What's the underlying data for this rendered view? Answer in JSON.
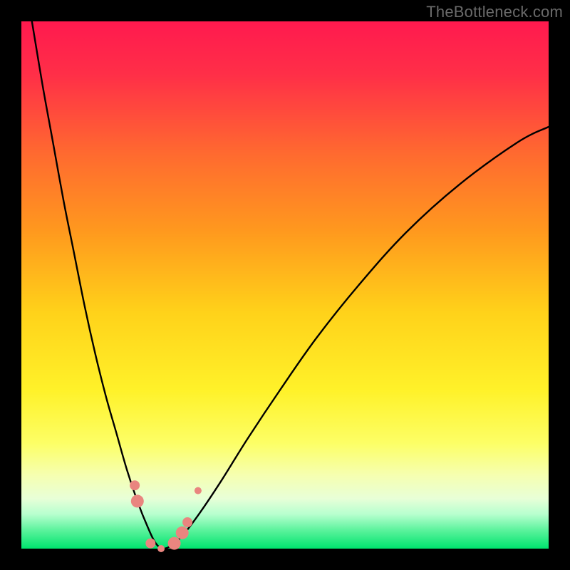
{
  "watermark": "TheBottleneck.com",
  "frame": {
    "outer_w": 800,
    "outer_h": 800,
    "inner_x": 30,
    "inner_y": 30,
    "inner_w": 740,
    "inner_h": 740
  },
  "gradient": {
    "stops": [
      {
        "offset": 0.0,
        "color": "#ff1a4f"
      },
      {
        "offset": 0.1,
        "color": "#ff2f48"
      },
      {
        "offset": 0.25,
        "color": "#ff6a30"
      },
      {
        "offset": 0.4,
        "color": "#ff9a1e"
      },
      {
        "offset": 0.55,
        "color": "#ffd21a"
      },
      {
        "offset": 0.7,
        "color": "#fff22a"
      },
      {
        "offset": 0.8,
        "color": "#fdff66"
      },
      {
        "offset": 0.86,
        "color": "#f6ffb0"
      },
      {
        "offset": 0.905,
        "color": "#e8ffd8"
      },
      {
        "offset": 0.935,
        "color": "#b7ffcf"
      },
      {
        "offset": 0.965,
        "color": "#5cf39d"
      },
      {
        "offset": 1.0,
        "color": "#00e46e"
      }
    ]
  },
  "curve_style": {
    "stroke": "#000000",
    "stroke_width": 2.4
  },
  "marker_style": {
    "fill": "#e9857f",
    "radius_small": 5,
    "radius_med": 7,
    "radius_large": 9
  },
  "chart_data": {
    "type": "line",
    "title": "",
    "xlabel": "",
    "ylabel": "",
    "xlim": [
      0,
      100
    ],
    "ylim": [
      0,
      100
    ],
    "grid": false,
    "notes": "V-shaped bottleneck curve. x is relative hardware balance (arbitrary 0–100 axis, no ticks shown). y is bottleneck severity 0–100 (0 = green band at bottom = no bottleneck, 100 = top red = severe). Minimum near x≈26 at y≈0. Highlighted sample points plotted as salmon dots near the trough.",
    "series": [
      {
        "name": "bottleneck_curve",
        "x": [
          2,
          4,
          6,
          8,
          10,
          12,
          14,
          16,
          18,
          20,
          22,
          24,
          25.5,
          27,
          29,
          31,
          34,
          38,
          43,
          49,
          56,
          64,
          73,
          83,
          94,
          100
        ],
        "y": [
          100,
          88,
          77,
          66,
          56,
          46,
          37,
          29,
          22,
          15,
          9,
          4,
          1,
          0,
          1,
          3,
          7,
          13,
          21,
          30,
          40,
          50,
          60,
          69,
          77,
          80
        ]
      }
    ],
    "markers": [
      {
        "x": 21.5,
        "y": 12,
        "size": "med"
      },
      {
        "x": 22.0,
        "y": 9,
        "size": "large"
      },
      {
        "x": 24.5,
        "y": 1,
        "size": "med"
      },
      {
        "x": 26.5,
        "y": 0,
        "size": "small"
      },
      {
        "x": 29.0,
        "y": 1,
        "size": "large"
      },
      {
        "x": 30.5,
        "y": 3,
        "size": "large"
      },
      {
        "x": 31.5,
        "y": 5,
        "size": "med"
      },
      {
        "x": 33.5,
        "y": 11,
        "size": "small"
      }
    ]
  }
}
